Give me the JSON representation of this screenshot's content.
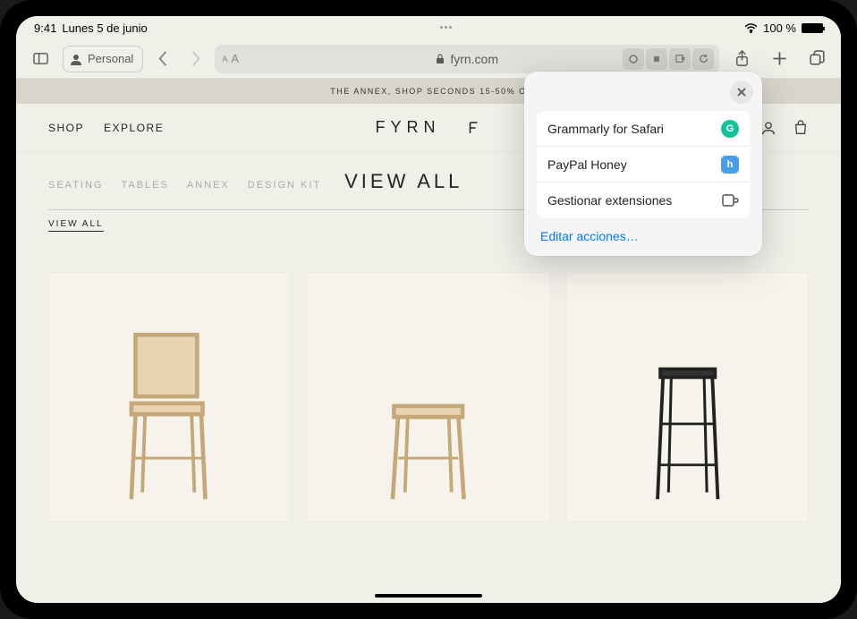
{
  "status": {
    "time": "9:41",
    "date": "Lunes 5 de junio",
    "battery": "100 %"
  },
  "safari": {
    "profile": "Personal",
    "aa": "AA",
    "url_host": "fyrn.com"
  },
  "site": {
    "promo": "THE ANNEX, SHOP SECONDS 15-50% O",
    "nav": {
      "shop": "SHOP",
      "explore": "EXPLORE"
    },
    "logo": "FYRN",
    "subnav": {
      "seating": "SEATING",
      "tables": "TABLES",
      "annex": "ANNEX",
      "design_kit": "DESIGN KIT",
      "view_all": "VIEW ALL"
    },
    "filter": "VIEW ALL"
  },
  "popover": {
    "items": [
      {
        "label": "Grammarly for Safari",
        "badge": "G",
        "badge_class": "grammarly"
      },
      {
        "label": "PayPal Honey",
        "badge": "h",
        "badge_class": "honey"
      }
    ],
    "manage": "Gestionar extensiones",
    "edit_actions": "Editar acciones…"
  }
}
